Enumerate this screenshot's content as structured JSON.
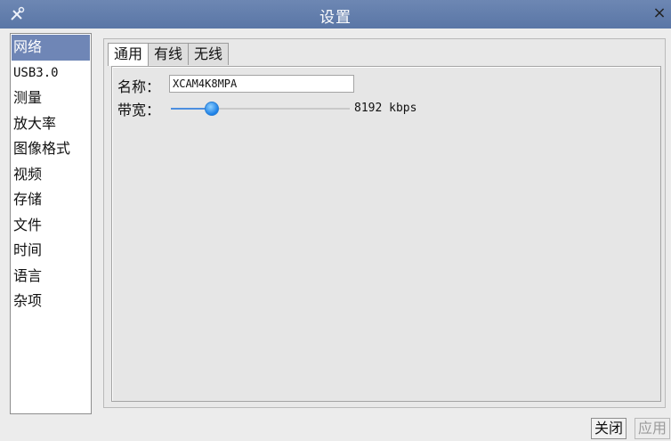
{
  "window": {
    "title": "设置",
    "close_glyph": "×",
    "app_icon": "tools-icon"
  },
  "sidebar": {
    "items": [
      {
        "label": "网络",
        "selected": true
      },
      {
        "label": "USB3.0"
      },
      {
        "label": "测量"
      },
      {
        "label": "放大率"
      },
      {
        "label": "图像格式"
      },
      {
        "label": "视频"
      },
      {
        "label": "存储"
      },
      {
        "label": "文件"
      },
      {
        "label": "时间"
      },
      {
        "label": "语言"
      },
      {
        "label": "杂项"
      }
    ]
  },
  "tabs": [
    {
      "label": "通用",
      "active": true
    },
    {
      "label": "有线"
    },
    {
      "label": "无线"
    }
  ],
  "general": {
    "name_label": "名称：",
    "name_value": "XCAM4K8MPA",
    "bandwidth_label": "带宽：",
    "bandwidth_fraction": 0.23,
    "bandwidth_value_text": "8192 kbps"
  },
  "footer": {
    "close_label": "关闭",
    "apply_label": "应用"
  },
  "colors": {
    "titlebar": "#5f7aa9",
    "selection": "#6f86b6",
    "slider_accent": "#1a7fe6"
  }
}
